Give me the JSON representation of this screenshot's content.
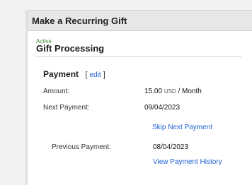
{
  "panel": {
    "title": "Make a Recurring Gift"
  },
  "gift": {
    "status": "Active",
    "title": "Gift Processing"
  },
  "payment": {
    "heading": "Payment",
    "edit_bracket_open": "[",
    "edit_label": "edit",
    "edit_bracket_close": "]",
    "amount_label": "Amount:",
    "amount_value": "15.00",
    "amount_currency": "USD",
    "amount_period": "/ Month",
    "next_label": "Next Payment:",
    "next_value": "09/04/2023",
    "skip_link": "Skip Next Payment",
    "previous_label": "Previous Payment:",
    "previous_value": "08/04/2023",
    "history_link": "View Payment History"
  },
  "colors": {
    "link": "#1a5fd6",
    "status": "#3a8f3a",
    "header_bg": "#e7e7e7"
  }
}
